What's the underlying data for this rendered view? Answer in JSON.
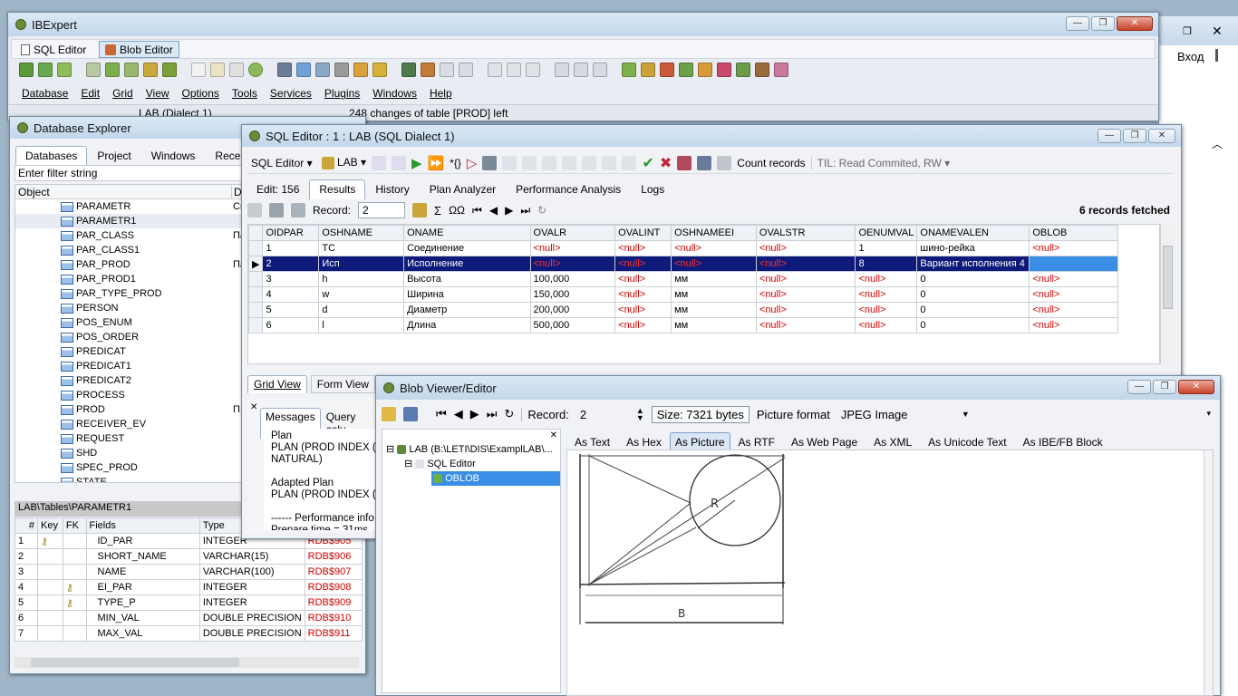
{
  "desktop": {
    "right_window_login": "Вход"
  },
  "main": {
    "title": "IBExpert",
    "tabs": [
      {
        "label": "SQL Editor"
      },
      {
        "label": "Blob Editor"
      }
    ],
    "menu": [
      "Database",
      "Edit",
      "Grid",
      "View",
      "Options",
      "Tools",
      "Services",
      "Plugins",
      "Windows",
      "Help"
    ],
    "status1": "LAB (Dialect 1)",
    "status2": "248 changes of table [PROD] left"
  },
  "explorer": {
    "title": "Database Explorer",
    "tabs": [
      "Databases",
      "Project",
      "Windows",
      "Recent"
    ],
    "filter_placeholder": "Enter filter string",
    "col_object": "Object",
    "col_d": "D",
    "items": [
      {
        "name": "PARAMETR",
        "d": "Cr"
      },
      {
        "name": "PARAMETR1",
        "d": ""
      },
      {
        "name": "PAR_CLASS",
        "d": "Па"
      },
      {
        "name": "PAR_CLASS1",
        "d": ""
      },
      {
        "name": "PAR_PROD",
        "d": "Па"
      },
      {
        "name": "PAR_PROD1",
        "d": ""
      },
      {
        "name": "PAR_TYPE_PROD",
        "d": ""
      },
      {
        "name": "PERSON",
        "d": ""
      },
      {
        "name": "POS_ENUM",
        "d": ""
      },
      {
        "name": "POS_ORDER",
        "d": ""
      },
      {
        "name": "PREDICAT",
        "d": ""
      },
      {
        "name": "PREDICAT1",
        "d": ""
      },
      {
        "name": "PREDICAT2",
        "d": ""
      },
      {
        "name": "PROCESS",
        "d": ""
      },
      {
        "name": "PROD",
        "d": "П."
      },
      {
        "name": "RECEIVER_EV",
        "d": ""
      },
      {
        "name": "REQUEST",
        "d": ""
      },
      {
        "name": "SHD",
        "d": ""
      },
      {
        "name": "SPEC_PROD",
        "d": ""
      },
      {
        "name": "STATE",
        "d": ""
      }
    ],
    "path": "LAB\\Tables\\PARAMETR1",
    "fields_header": {
      "num": "#",
      "key": "Key",
      "fk": "FK",
      "fields": "Fields",
      "type": "Type"
    },
    "fields": [
      {
        "n": "1",
        "key": "pk",
        "fk": "",
        "name": "ID_PAR",
        "type": "INTEGER",
        "rdb": "RDB$905"
      },
      {
        "n": "2",
        "key": "",
        "fk": "",
        "name": "SHORT_NAME",
        "type": "VARCHAR(15)",
        "rdb": "RDB$906"
      },
      {
        "n": "3",
        "key": "",
        "fk": "",
        "name": "NAME",
        "type": "VARCHAR(100)",
        "rdb": "RDB$907"
      },
      {
        "n": "4",
        "key": "",
        "fk": "fk",
        "name": "EI_PAR",
        "type": "INTEGER",
        "rdb": "RDB$908"
      },
      {
        "n": "5",
        "key": "",
        "fk": "fk",
        "name": "TYPE_P",
        "type": "INTEGER",
        "rdb": "RDB$909"
      },
      {
        "n": "6",
        "key": "",
        "fk": "",
        "name": "MIN_VAL",
        "type": "DOUBLE PRECISION",
        "rdb": "RDB$910"
      },
      {
        "n": "7",
        "key": "",
        "fk": "",
        "name": "MAX_VAL",
        "type": "DOUBLE PRECISION",
        "rdb": "RDB$911"
      }
    ]
  },
  "sql": {
    "title": "SQL Editor : 1 : LAB (SQL Dialect 1)",
    "toolbar": {
      "editor": "SQL Editor",
      "db": "LAB",
      "count": "Count records",
      "til": "TIL: Read Commited, RW"
    },
    "tabs": [
      "Edit: 156",
      "Results",
      "History",
      "Plan Analyzer",
      "Performance Analysis",
      "Logs"
    ],
    "record_label": "Record:",
    "record_value": "2",
    "fetched": "6 records fetched",
    "columns": [
      "OIDPAR",
      "OSHNAME",
      "ONAME",
      "OVALR",
      "OVALINT",
      "OSHNAMEEI",
      "OVALSTR",
      "OENUMVAL",
      "ONAMEVALEN",
      "OBLOB"
    ],
    "rows": [
      [
        "1",
        "TC",
        "Соединение",
        "<null>",
        "<null>",
        "<null>",
        "<null>",
        "1",
        "шино-рейка",
        "<null>"
      ],
      [
        "2",
        "Исп",
        "Исполнение",
        "<null>",
        "<null>",
        "<null>",
        "<null>",
        "8",
        "Вариант исполнения 4",
        ""
      ],
      [
        "3",
        "h",
        "Высота",
        "100,000",
        "<null>",
        "мм",
        "<null>",
        "<null>",
        "0",
        "<null>"
      ],
      [
        "4",
        "w",
        "Ширина",
        "150,000",
        "<null>",
        "мм",
        "<null>",
        "<null>",
        "0",
        "<null>"
      ],
      [
        "5",
        "d",
        "Диаметр",
        "200,000",
        "<null>",
        "мм",
        "<null>",
        "<null>",
        "0",
        "<null>"
      ],
      [
        "6",
        "l",
        "Длина",
        "500,000",
        "<null>",
        "мм",
        "<null>",
        "<null>",
        "0",
        "<null>"
      ]
    ],
    "view_tabs": [
      "Grid View",
      "Form View"
    ],
    "msg_tabs": [
      "Messages",
      "Query colu"
    ],
    "messages": [
      "Plan",
      "PLAN (PROD INDEX (RD",
      "NATURAL)",
      "",
      "Adapted Plan",
      "PLAN (PROD INDEX (INT",
      "",
      "------ Performance info",
      "Prepare time = 31ms"
    ]
  },
  "blob": {
    "title": "Blob Viewer/Editor",
    "record_label": "Record:",
    "record_value": "2",
    "size": "Size: 7321 bytes",
    "format_label": "Picture format",
    "format_value": "JPEG Image",
    "tree": [
      "LAB (B:\\LETI\\DIS\\ExamplLAB\\...",
      "SQL Editor",
      "OBLOB"
    ],
    "tabs": [
      "As Text",
      "As Hex",
      "As Picture",
      "As RTF",
      "As Web Page",
      "As XML",
      "As Unicode Text",
      "As IBE/FB Block"
    ],
    "picture_labels": {
      "r": "R",
      "b": "B"
    }
  }
}
